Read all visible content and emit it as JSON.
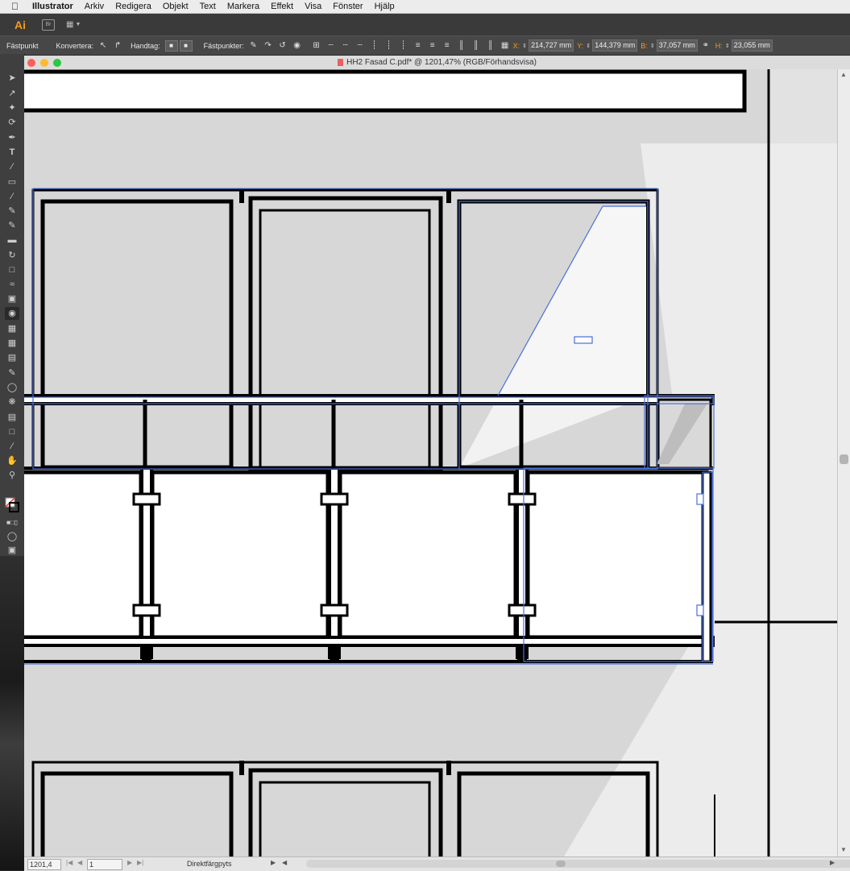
{
  "menu": {
    "app_name": "Illustrator",
    "items": [
      "Arkiv",
      "Redigera",
      "Objekt",
      "Text",
      "Markera",
      "Effekt",
      "Visa",
      "Fönster",
      "Hjälp"
    ]
  },
  "appbar": {
    "logo": "Ai",
    "bridge_label": "Br"
  },
  "control": {
    "anchor_label": "Fästpunkt",
    "convert_label": "Konvertera:",
    "handles_label": "Handtag:",
    "anchors_label": "Fästpunkter:",
    "x_label": "X:",
    "x_value": "214,727 mm",
    "y_label": "Y:",
    "y_value": "144,379 mm",
    "w_label": "B:",
    "w_value": "37,057 mm",
    "h_label": "H:",
    "h_value": "23,055 mm"
  },
  "document": {
    "title": "HH2 Fasad C.pdf* @ 1201,47% (RGB/Förhandsvisa)"
  },
  "status": {
    "zoom": "1201,4",
    "artboard": "1",
    "tool_hint": "Direktfärgpyts"
  },
  "icons": {
    "apple": "apple-icon",
    "tools": [
      "selection-icon",
      "direct-selection-icon",
      "magic-wand-icon",
      "lasso-icon",
      "pen-icon",
      "type-icon",
      "line-icon",
      "rectangle-icon",
      "paintbrush-icon",
      "pencil-icon",
      "shaper-icon",
      "eraser-icon",
      "rotate-icon",
      "scale-icon",
      "width-icon",
      "free-transform-icon",
      "shape-builder-icon",
      "perspective-icon",
      "mesh-icon",
      "gradient-icon",
      "eyedropper-icon",
      "blend-icon",
      "symbol-sprayer-icon",
      "column-graph-icon",
      "artboard-icon",
      "slice-icon",
      "hand-icon",
      "zoom-icon"
    ]
  },
  "colors": {
    "selection": "#4a6fd8",
    "canvas_grey": "#d7d7d7",
    "ai_orange": "#f49b1f"
  }
}
